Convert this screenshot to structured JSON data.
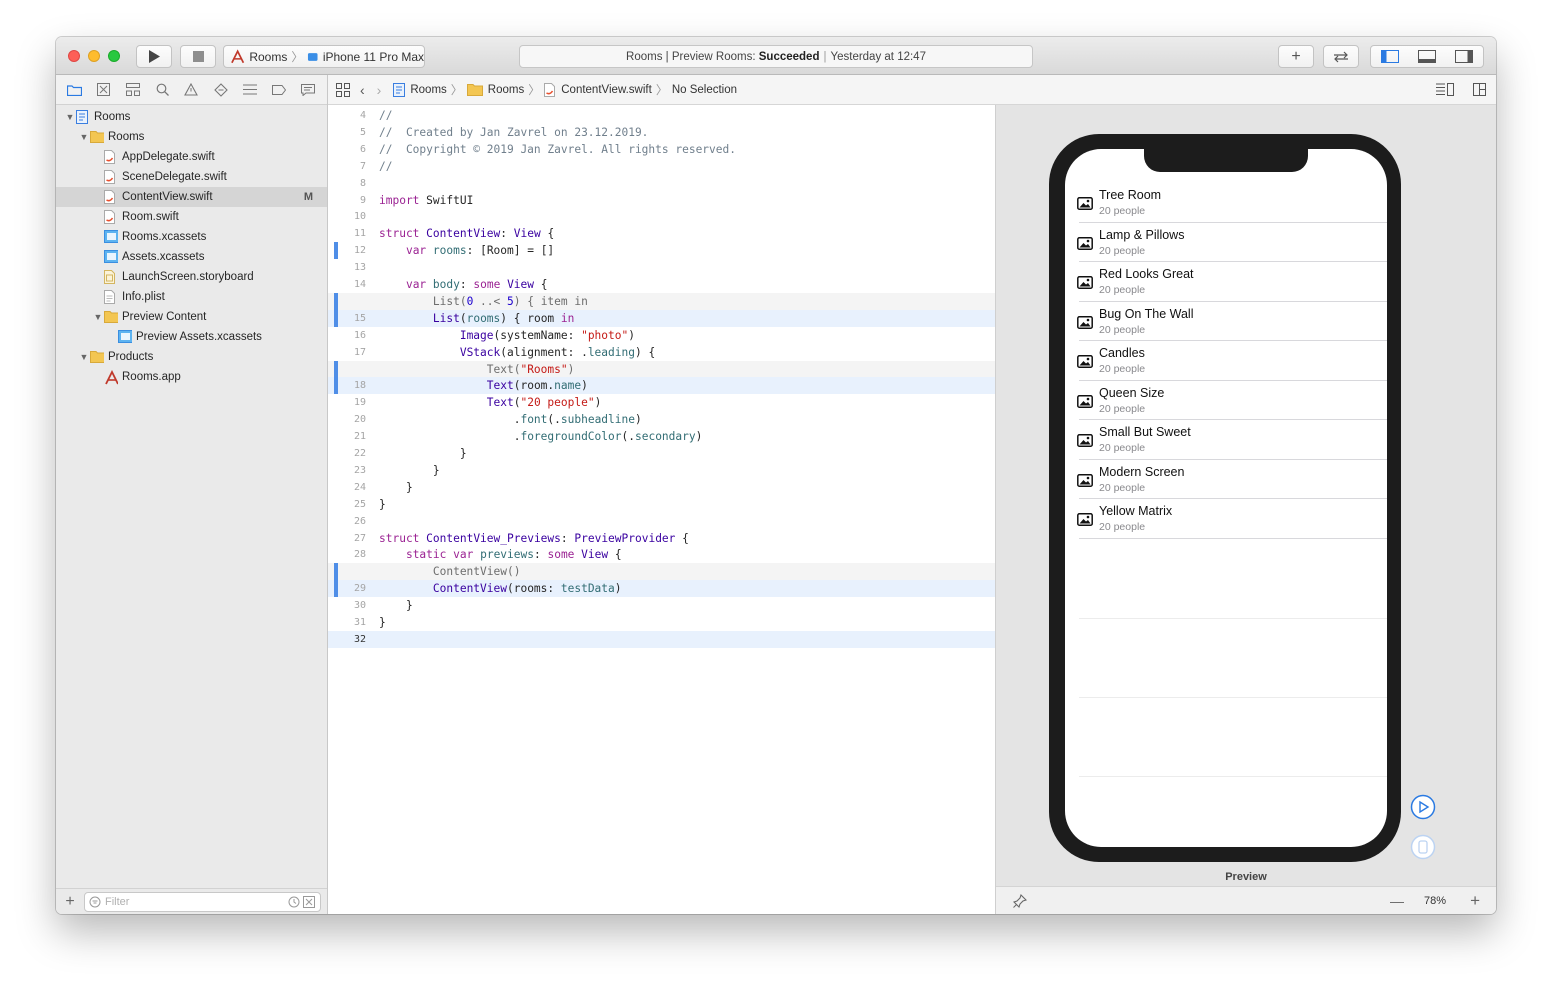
{
  "toolbar": {
    "scheme_project": "Rooms",
    "scheme_device": "iPhone 11 Pro Max",
    "status_prefix": "Rooms | Preview Rooms:",
    "status_result": "Succeeded",
    "status_time": "Yesterday at 12:47"
  },
  "navigator": {
    "items": [
      {
        "label": "Rooms",
        "indent": 0,
        "icon": "project-icon",
        "disclosure": "open"
      },
      {
        "label": "Rooms",
        "indent": 1,
        "icon": "folder-icon",
        "disclosure": "open"
      },
      {
        "label": "AppDelegate.swift",
        "indent": 2,
        "icon": "swift-file-icon"
      },
      {
        "label": "SceneDelegate.swift",
        "indent": 2,
        "icon": "swift-file-icon"
      },
      {
        "label": "ContentView.swift",
        "indent": 2,
        "icon": "swift-file-icon",
        "selected": true,
        "badge": "M"
      },
      {
        "label": "Room.swift",
        "indent": 2,
        "icon": "swift-file-icon"
      },
      {
        "label": "Rooms.xcassets",
        "indent": 2,
        "icon": "assets-icon"
      },
      {
        "label": "Assets.xcassets",
        "indent": 2,
        "icon": "assets-icon"
      },
      {
        "label": "LaunchScreen.storyboard",
        "indent": 2,
        "icon": "storyboard-icon"
      },
      {
        "label": "Info.plist",
        "indent": 2,
        "icon": "plist-icon"
      },
      {
        "label": "Preview Content",
        "indent": 2,
        "icon": "folder-icon",
        "disclosure": "open"
      },
      {
        "label": "Preview Assets.xcassets",
        "indent": 3,
        "icon": "assets-icon"
      },
      {
        "label": "Products",
        "indent": 1,
        "icon": "folder-icon",
        "disclosure": "open"
      },
      {
        "label": "Rooms.app",
        "indent": 2,
        "icon": "app-icon"
      }
    ],
    "filter_placeholder": "Filter"
  },
  "jumpbar": {
    "crumbs": [
      "Rooms",
      "Rooms",
      "ContentView.swift",
      "No Selection"
    ]
  },
  "editor": {
    "lines": [
      {
        "n": "4",
        "html": "<span class=\"cm\">//</span>"
      },
      {
        "n": "5",
        "html": "<span class=\"cm\">//  Created by Jan Zavrel on 23.12.2019.</span>"
      },
      {
        "n": "6",
        "html": "<span class=\"cm\">//  Copyright © 2019 Jan Zavrel. All rights reserved.</span>"
      },
      {
        "n": "7",
        "html": "<span class=\"cm\">//</span>"
      },
      {
        "n": "8",
        "html": ""
      },
      {
        "n": "9",
        "html": "<span class=\"kw\">import</span> SwiftUI"
      },
      {
        "n": "10",
        "html": ""
      },
      {
        "n": "11",
        "html": "<span class=\"kw\">struct</span> <span class=\"ty\">ContentView</span>: <span class=\"ty\">View</span> {"
      },
      {
        "n": "12",
        "html": "    <span class=\"kw\">var</span> <span class=\"id\">rooms</span>: [Room] = []",
        "change": true
      },
      {
        "n": "13",
        "html": ""
      },
      {
        "n": "14",
        "html": "    <span class=\"kw\">var</span> <span class=\"id\">body</span>: <span class=\"kw\">some</span> <span class=\"ty\">View</span> {"
      },
      {
        "n": "",
        "html": "        List(<span class=\"num\">0</span> ..< <span class=\"num\">5</span>) { item in",
        "ghost": true
      },
      {
        "n": "15",
        "html": "        <span class=\"ty\">List</span>(<span class=\"id\">rooms</span>) { room <span class=\"kw\">in</span>",
        "hl": true
      },
      {
        "n": "16",
        "html": "            <span class=\"ty\">Image</span>(systemName: <span class=\"str\">\"photo\"</span>)"
      },
      {
        "n": "17",
        "html": "            <span class=\"ty\">VStack</span>(alignment: .<span class=\"id\">leading</span>) {"
      },
      {
        "n": "",
        "html": "                Text(<span class=\"str\">\"Rooms\"</span>)",
        "ghost": true
      },
      {
        "n": "18",
        "html": "                <span class=\"ty\">Text</span>(room.<span class=\"id\">name</span>)",
        "hl": true
      },
      {
        "n": "19",
        "html": "                <span class=\"ty\">Text</span>(<span class=\"str\">\"20 people\"</span>)"
      },
      {
        "n": "20",
        "html": "                    .<span class=\"id\">font</span>(.<span class=\"id\">subheadline</span>)"
      },
      {
        "n": "21",
        "html": "                    .<span class=\"id\">foregroundColor</span>(.<span class=\"id\">secondary</span>)"
      },
      {
        "n": "22",
        "html": "            }"
      },
      {
        "n": "23",
        "html": "        }"
      },
      {
        "n": "24",
        "html": "    }"
      },
      {
        "n": "25",
        "html": "}"
      },
      {
        "n": "26",
        "html": ""
      },
      {
        "n": "27",
        "html": "<span class=\"kw\">struct</span> <span class=\"ty\">ContentView_Previews</span>: <span class=\"ty\">PreviewProvider</span> {"
      },
      {
        "n": "28",
        "html": "    <span class=\"kw\">static</span> <span class=\"kw\">var</span> <span class=\"id\">previews</span>: <span class=\"kw\">some</span> <span class=\"ty\">View</span> {"
      },
      {
        "n": "",
        "html": "        ContentView()",
        "ghost": true
      },
      {
        "n": "29",
        "html": "        <span class=\"ty\">ContentView</span>(rooms: <span class=\"id\">testData</span>)",
        "hl": true
      },
      {
        "n": "30",
        "html": "    }"
      },
      {
        "n": "31",
        "html": "}"
      },
      {
        "n": "32",
        "html": "",
        "current": true
      }
    ]
  },
  "preview": {
    "rooms": [
      {
        "name": "Tree Room",
        "sub": "20 people"
      },
      {
        "name": "Lamp & Pillows",
        "sub": "20 people"
      },
      {
        "name": "Red Looks Great",
        "sub": "20 people"
      },
      {
        "name": "Bug On The Wall",
        "sub": "20 people"
      },
      {
        "name": "Candles",
        "sub": "20 people"
      },
      {
        "name": "Queen Size",
        "sub": "20 people"
      },
      {
        "name": "Small But Sweet",
        "sub": "20 people"
      },
      {
        "name": "Modern Screen",
        "sub": "20 people"
      },
      {
        "name": "Yellow Matrix",
        "sub": "20 people"
      }
    ],
    "label": "Preview",
    "zoom": "78%"
  },
  "colors": {
    "accent": "#4f8ee7",
    "selection_row": "#d5d5d5",
    "line_highlight": "#e8f1fd"
  }
}
